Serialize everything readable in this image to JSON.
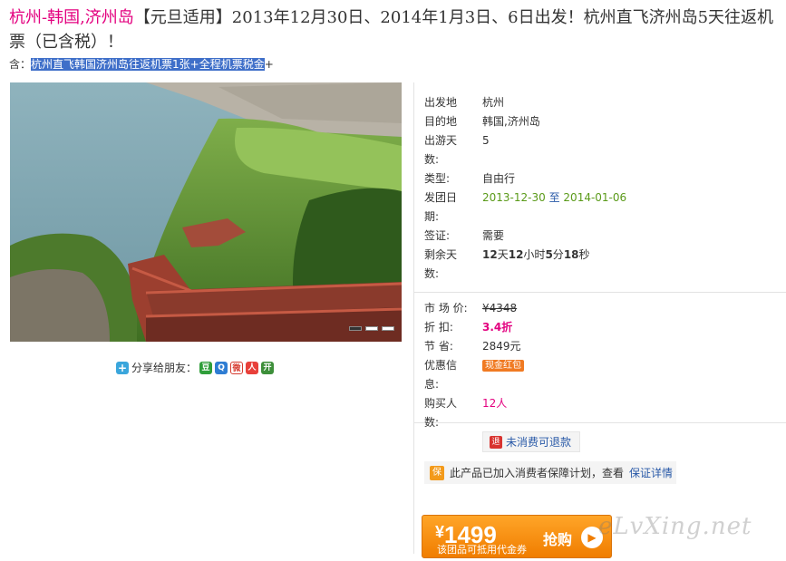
{
  "title": {
    "destination": "杭州-韩国,济州岛",
    "rest": "【元旦适用】2013年12月30日、2014年1月3日、6日出发！杭州直飞济州岛5天往返机票（已含税）！"
  },
  "includes": {
    "label": "含：",
    "highlight": "杭州直飞韩国济州岛往返机票1张+全程机票税金",
    "suffix": "+"
  },
  "gallery": {
    "slide_count": 3,
    "active_index": 0
  },
  "share": {
    "label": "分享给朋友：",
    "icons": [
      "douban-icon",
      "qzone-icon",
      "weibo-icon",
      "renren-icon",
      "kaixin-icon"
    ]
  },
  "details": {
    "origin": {
      "label": "出发地",
      "value": "杭州"
    },
    "destination": {
      "label": "目的地",
      "value": "韩国,济州岛"
    },
    "days": {
      "label": "出游天数:",
      "value": "5"
    },
    "type": {
      "label": "类型:",
      "value": "自由行"
    },
    "departure": {
      "label": "发团日期:",
      "start": "2013-12-30",
      "sep": "至",
      "end": "2014-01-06"
    },
    "visa": {
      "label": "签证:",
      "value": "需要"
    },
    "remaining": {
      "label": "剩余天数:",
      "days": "12",
      "d_unit": "天",
      "hours": "12",
      "h_unit": "小时",
      "minutes": "5",
      "m_unit": "分",
      "seconds": "18",
      "s_unit": "秒"
    }
  },
  "pricing": {
    "market": {
      "label": "市 场 价:",
      "value": "¥4348"
    },
    "discount": {
      "label": "折 扣:",
      "value": "3.4折"
    },
    "saved": {
      "label": "节 省:",
      "value": "2849元"
    },
    "promo": {
      "label": "优惠信息:",
      "badge": "现金红包"
    },
    "buyers": {
      "label": "购买人数:",
      "value": "12人"
    }
  },
  "refund": {
    "icon_text": "退",
    "label": "未消费可退款"
  },
  "guarantee": {
    "icon_text": "保",
    "text": "此产品已加入消费者保障计划，查看",
    "link": "保证详情"
  },
  "buy": {
    "currency": "¥",
    "price": "1499",
    "subtitle": "该团品可抵用代金券",
    "action": "抢购",
    "arrow": "▶"
  },
  "watermark": "eLvXing.net",
  "colors": {
    "accent": "#e3007f",
    "date_green": "#5a9a19",
    "buy_orange": "#f07d00",
    "link_blue": "#2a5aa8"
  }
}
